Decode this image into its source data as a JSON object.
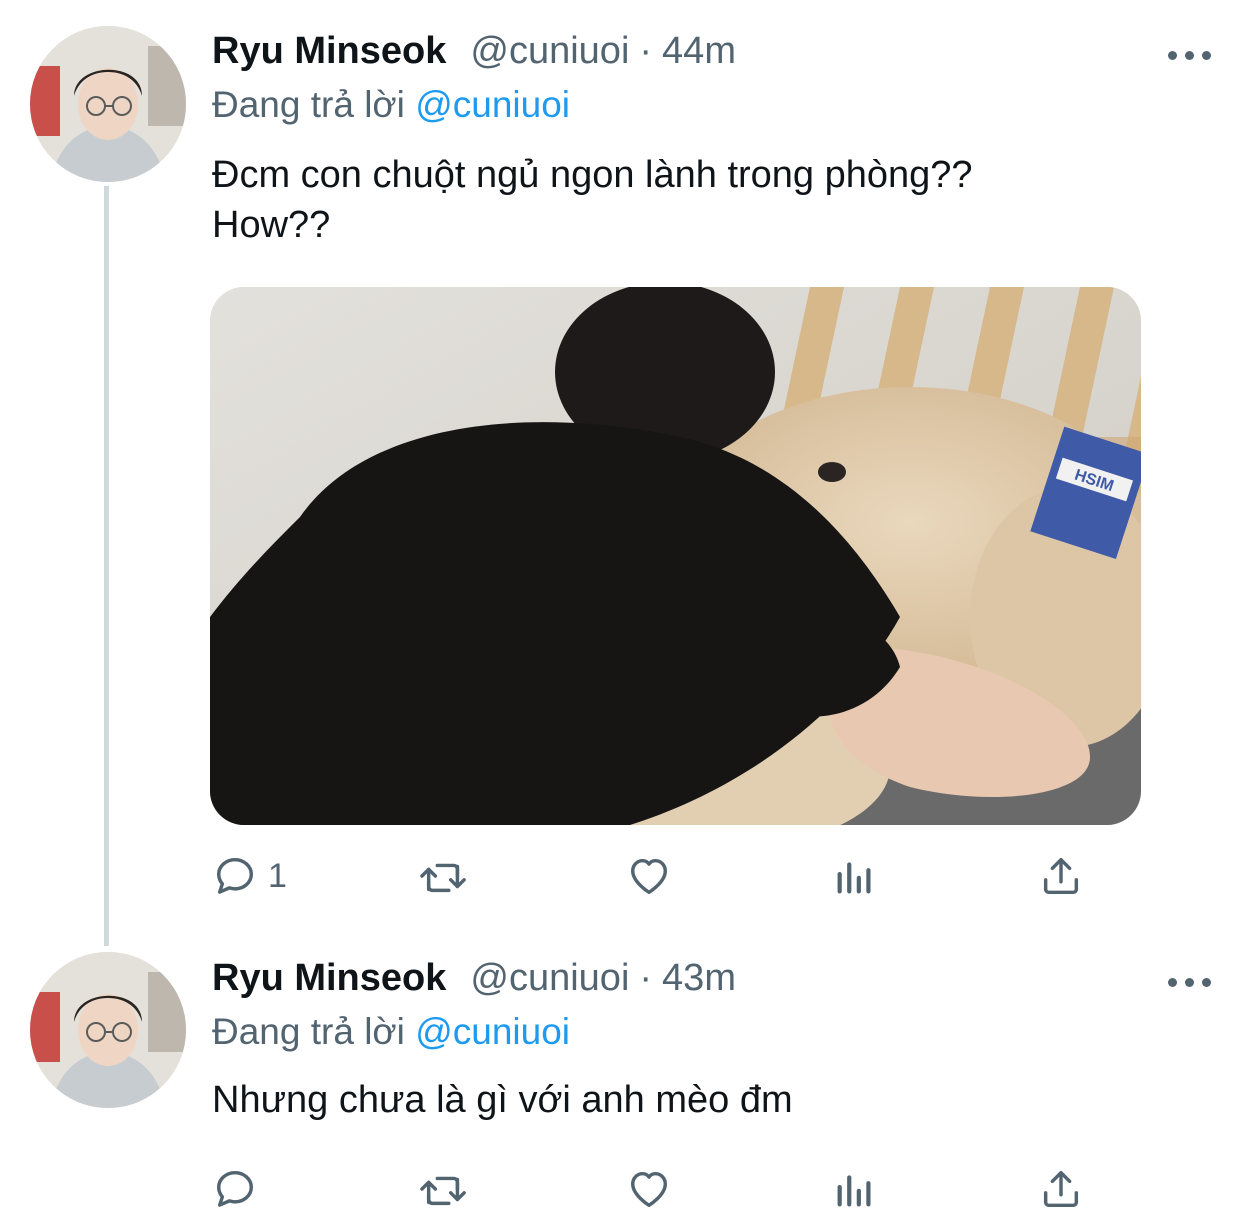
{
  "tweets": [
    {
      "author_name": "Ryu Minseok",
      "handle": "@cuniuoi",
      "separator": "·",
      "time": "44m",
      "reply_prefix": "Đang trả lời",
      "reply_to": "@cuniuoi",
      "text": "Đcm con chuột ngủ ngon lành trong phòng??\nHow??",
      "has_media": true,
      "reply_count": "1",
      "actions": [
        "reply-icon",
        "retweet-icon",
        "like-icon",
        "analytics-icon",
        "share-icon"
      ]
    },
    {
      "author_name": "Ryu Minseok",
      "handle": "@cuniuoi",
      "separator": "·",
      "time": "43m",
      "reply_prefix": "Đang trả lời",
      "reply_to": "@cuniuoi",
      "text": "Nhưng chưa là gì với anh mèo đm",
      "has_media": false,
      "reply_count": "",
      "actions": [
        "reply-icon",
        "retweet-icon",
        "like-icon",
        "analytics-icon",
        "share-icon"
      ]
    }
  ],
  "colors": {
    "text_primary": "#0f1419",
    "text_secondary": "#536471",
    "link": "#1d9bf0",
    "thread_line": "#cfd9de"
  },
  "media_label_text": "HSIM"
}
